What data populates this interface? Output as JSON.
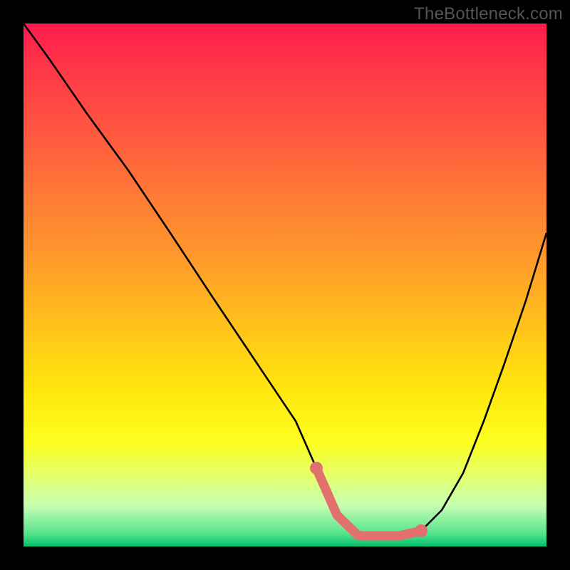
{
  "watermark": "TheBottleneck.com",
  "chart_data": {
    "type": "line",
    "title": "",
    "xlabel": "",
    "ylabel": "",
    "xlim": [
      0,
      100
    ],
    "ylim": [
      0,
      100
    ],
    "series": [
      {
        "name": "bottleneck-curve",
        "x": [
          0,
          5,
          12,
          20,
          28,
          36,
          44,
          52,
          56,
          60,
          64,
          68,
          72,
          76,
          80,
          84,
          88,
          92,
          96,
          100
        ],
        "y": [
          100,
          93,
          83,
          72,
          60,
          48,
          36,
          24,
          15,
          6,
          2,
          2,
          2,
          3,
          7,
          14,
          24,
          35,
          47,
          60
        ]
      }
    ],
    "band": {
      "name": "optimal-range",
      "x_start": 56,
      "x_end": 76,
      "color": "#e2716d"
    },
    "markers": [
      {
        "name": "band-start-dot",
        "x": 56,
        "y": 15,
        "color": "#e2716d"
      },
      {
        "name": "band-end-dot",
        "x": 76,
        "y": 3,
        "color": "#e2716d"
      }
    ],
    "background_gradient": {
      "orientation": "vertical",
      "stops": [
        {
          "pos": 0.0,
          "color": "#ff1a4d"
        },
        {
          "pos": 0.5,
          "color": "#ffb020"
        },
        {
          "pos": 0.8,
          "color": "#fcff1f"
        },
        {
          "pos": 1.0,
          "color": "#00c06a"
        }
      ]
    }
  }
}
